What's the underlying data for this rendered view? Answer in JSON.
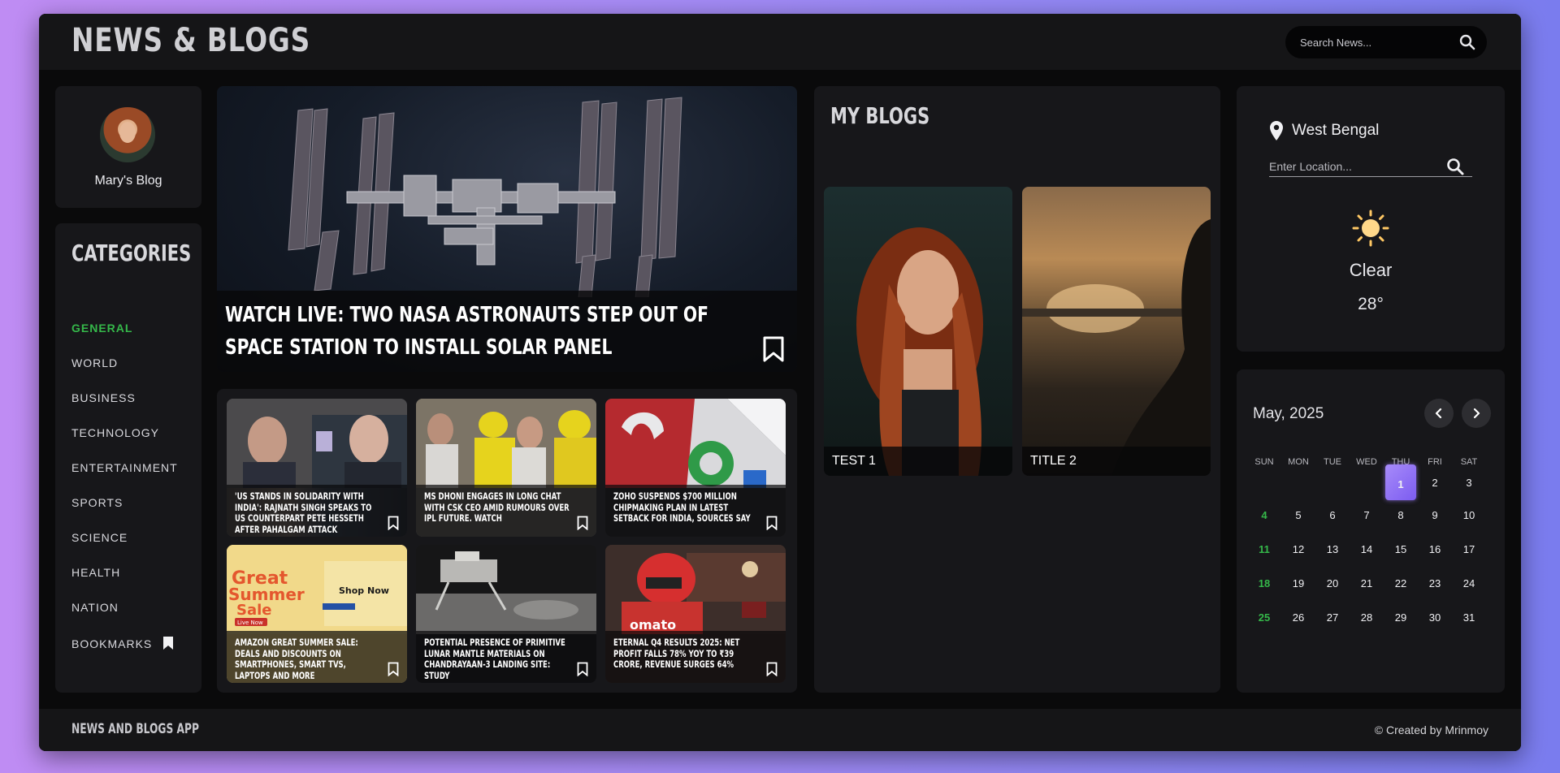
{
  "header": {
    "title": "NEWS & BLOGS",
    "search_placeholder": "Search News..."
  },
  "profile": {
    "name": "Mary's Blog"
  },
  "categories": {
    "title": "CATEGORIES",
    "items": [
      {
        "label": "GENERAL",
        "active": true
      },
      {
        "label": "WORLD"
      },
      {
        "label": "BUSINESS"
      },
      {
        "label": "TECHNOLOGY"
      },
      {
        "label": "ENTERTAINMENT"
      },
      {
        "label": "SPORTS"
      },
      {
        "label": "SCIENCE"
      },
      {
        "label": "HEALTH"
      },
      {
        "label": "NATION"
      },
      {
        "label": "BOOKMARKS"
      }
    ]
  },
  "headline": {
    "title": "WATCH LIVE: TWO NASA ASTRONAUTS STEP OUT OF SPACE STATION TO INSTALL SOLAR PANEL"
  },
  "news": [
    {
      "title": "'US STANDS IN SOLIDARITY WITH INDIA': RAJNATH SINGH SPEAKS TO US COUNTERPART PETE HESSETH AFTER PAHALGAM ATTACK"
    },
    {
      "title": "MS DHONI ENGAGES IN LONG CHAT WITH CSK CEO AMID RUMOURS OVER IPL FUTURE. WATCH"
    },
    {
      "title": "ZOHO SUSPENDS $700 MILLION CHIPMAKING PLAN IN LATEST SETBACK FOR INDIA, SOURCES SAY"
    },
    {
      "title": "AMAZON GREAT SUMMER SALE: DEALS AND DISCOUNTS ON SMARTPHONES, SMART TVS, LAPTOPS AND MORE"
    },
    {
      "title": "POTENTIAL PRESENCE OF PRIMITIVE LUNAR MANTLE MATERIALS ON CHANDRAYAAN-3 LANDING SITE: STUDY"
    },
    {
      "title": "ETERNAL Q4 RESULTS 2025: NET PROFIT FALLS 78% YOY TO ₹39 CRORE, REVENUE SURGES 64%"
    }
  ],
  "news_image_text": {
    "amazon_line1": "Great",
    "amazon_line2": "Summer",
    "amazon_line3": "Sale",
    "amazon_shop": "Shop Now",
    "amazon_live": "Live Now",
    "zomato_text": "omato"
  },
  "blogs": {
    "title": "MY BLOGS",
    "items": [
      {
        "title": "TEST 1"
      },
      {
        "title": "TITLE 2"
      }
    ]
  },
  "weather": {
    "location": "West Bengal",
    "location_placeholder": "Enter Location...",
    "condition": "Clear",
    "temperature": "28°",
    "icon": "sun-icon"
  },
  "calendar": {
    "month_label": "May, 2025",
    "weekdays": [
      "SUN",
      "MON",
      "TUE",
      "WED",
      "THU",
      "FRI",
      "SAT"
    ],
    "first_weekday_index": 4,
    "days_in_month": 31,
    "today": 1
  },
  "footer": {
    "brand": "NEWS AND BLOGS APP",
    "credit": "© Created by Mrinmoy"
  },
  "colors": {
    "accent_green": "#35b84a",
    "today_purple": "#8b6ef5",
    "panel_bg": "#17171a",
    "app_bg": "#0a0a0b"
  }
}
